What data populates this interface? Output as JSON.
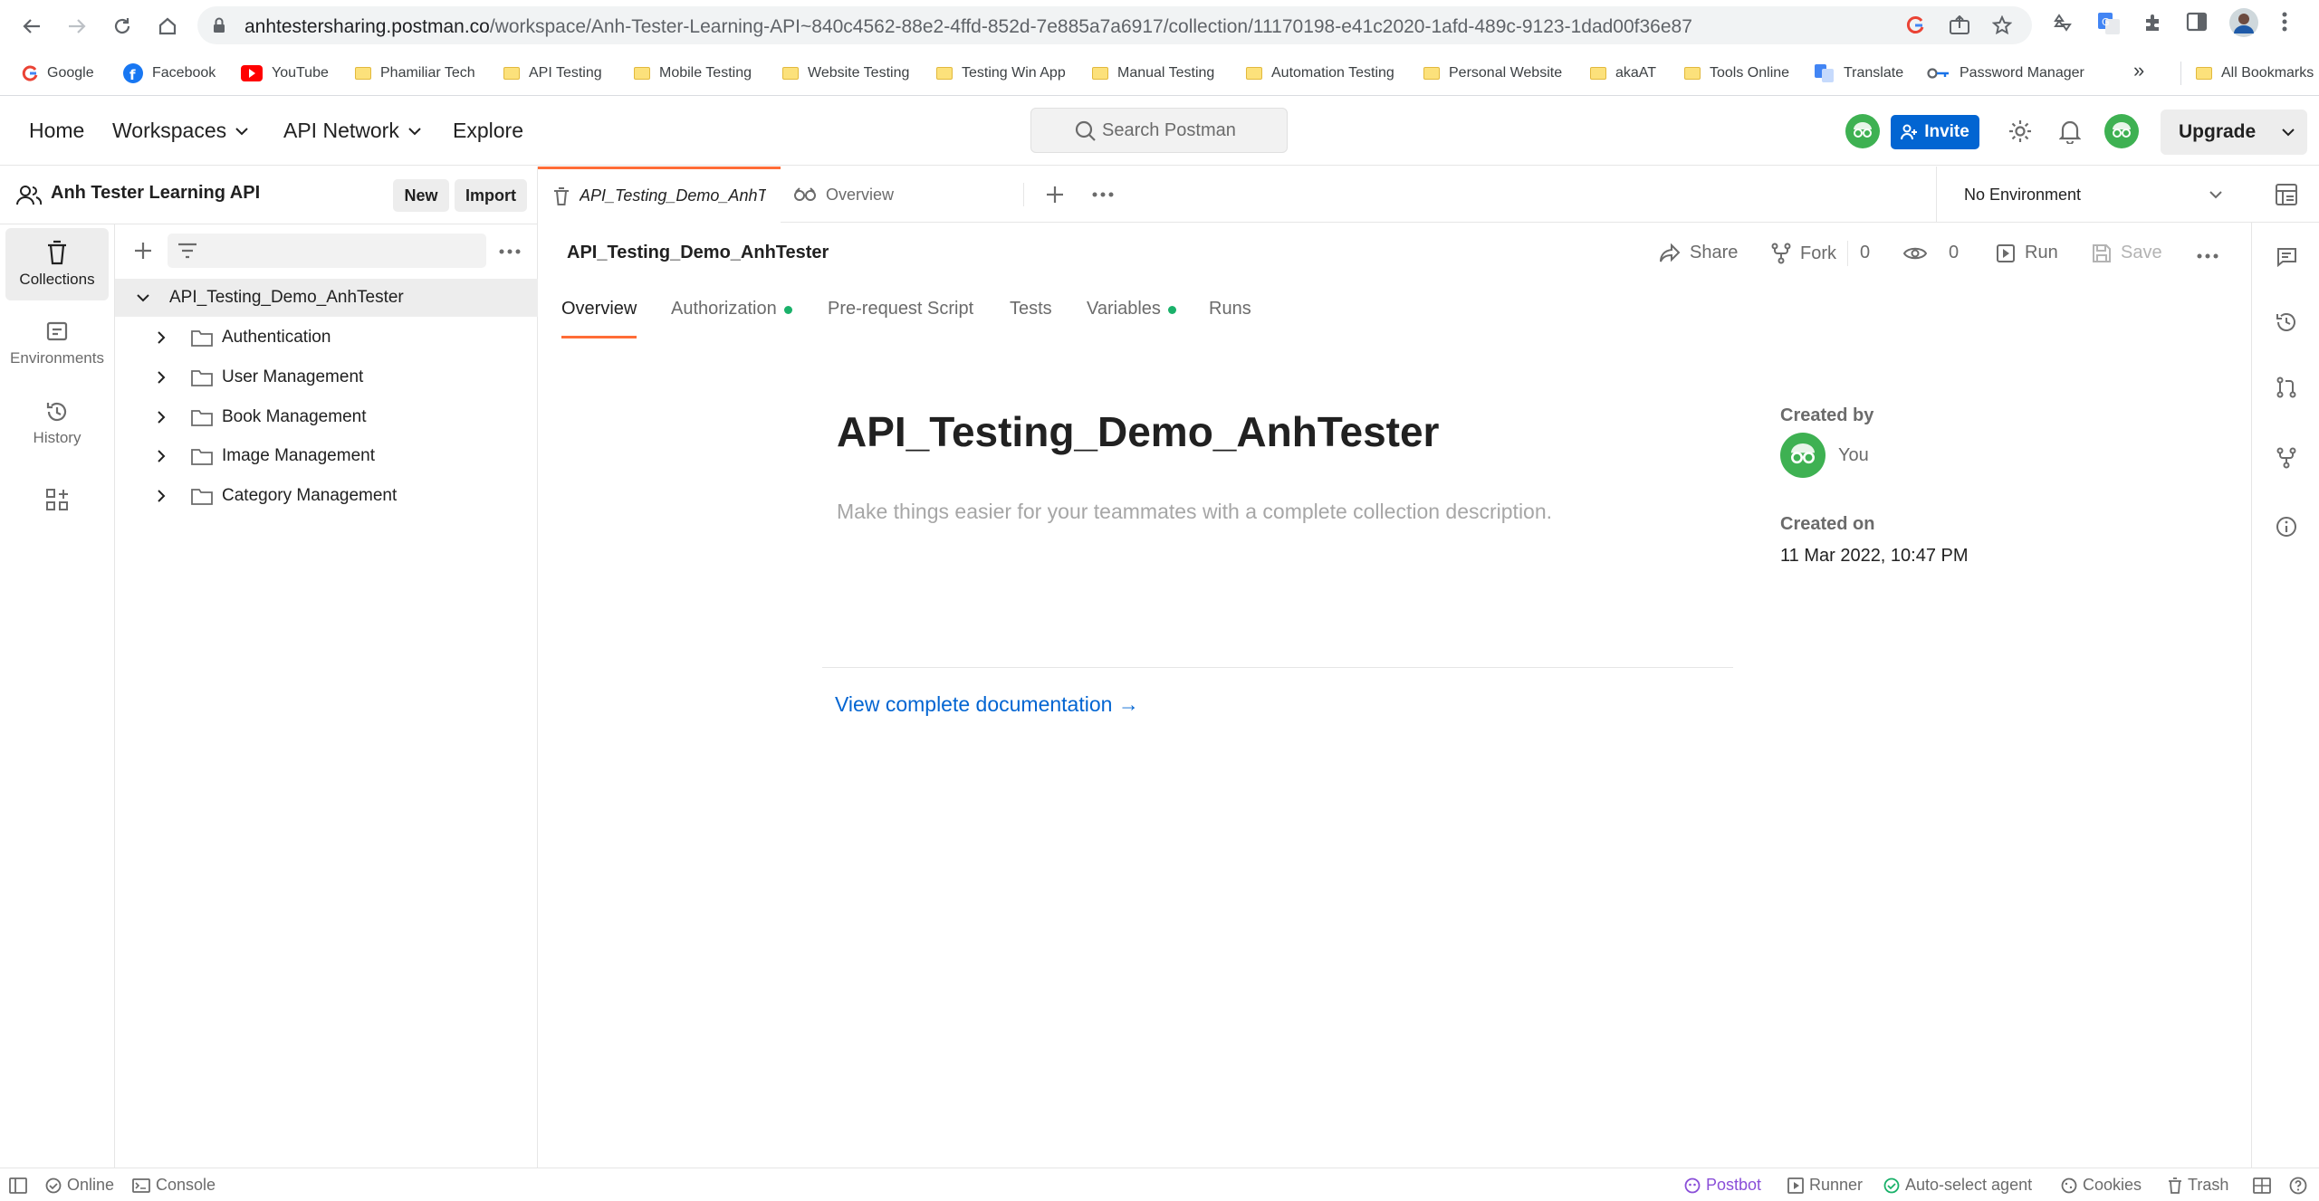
{
  "browser": {
    "url_host": "anhtestersharing.postman.co",
    "url_path": "/workspace/Anh-Tester-Learning-API~840c4562-88e2-4ffd-852d-7e885a7a6917/collection/11170198-e41c2020-1afd-489c-9123-1dad00f36e87",
    "bookmarks": [
      "Google",
      "Facebook",
      "YouTube",
      "Phamiliar Tech",
      "API Testing",
      "Mobile Testing",
      "Website Testing",
      "Testing Win App",
      "Manual Testing",
      "Automation Testing",
      "Personal Website",
      "akaAT",
      "Tools Online",
      "Translate",
      "Password Manager"
    ],
    "more_bookmarks": "»",
    "all_bookmarks": "All Bookmarks"
  },
  "header": {
    "home": "Home",
    "workspaces": "Workspaces",
    "api_network": "API Network",
    "explore": "Explore",
    "search_placeholder": "Search Postman",
    "invite": "Invite",
    "upgrade": "Upgrade"
  },
  "workspace": {
    "name": "Anh Tester Learning API",
    "new_button": "New",
    "import_button": "Import"
  },
  "rail": {
    "collections": "Collections",
    "environments": "Environments",
    "history": "History"
  },
  "tree": {
    "collection": "API_Testing_Demo_AnhTester",
    "folders": [
      "Authentication",
      "User Management",
      "Book Management",
      "Image Management",
      "Category Management"
    ]
  },
  "tabs": {
    "collection_tab": "API_Testing_Demo_AnhTe",
    "overview_tab": "Overview",
    "environment": "No Environment"
  },
  "collection": {
    "name": "API_Testing_Demo_AnhTester",
    "share": "Share",
    "fork": "Fork",
    "fork_count": "0",
    "watch_count": "0",
    "run": "Run",
    "save": "Save",
    "subtabs": [
      "Overview",
      "Authorization",
      "Pre-request Script",
      "Tests",
      "Variables",
      "Runs"
    ],
    "title": "API_Testing_Demo_AnhTester",
    "description_placeholder": "Make things easier for your teammates with a complete collection description.",
    "doc_link": "View complete documentation →",
    "created_by_label": "Created by",
    "created_by": "You",
    "created_on_label": "Created on",
    "created_on": "11 Mar 2022, 10:47 PM"
  },
  "statusbar": {
    "online": "Online",
    "console": "Console",
    "postbot": "Postbot",
    "runner": "Runner",
    "agent": "Auto-select agent",
    "cookies": "Cookies",
    "trash": "Trash"
  },
  "colors": {
    "accent": "#ff6c37",
    "invite_blue": "#0265d2",
    "avatar_green": "#3eb152",
    "status_dot": "#1ab16a",
    "postbot_purple": "#8a4fd8"
  }
}
